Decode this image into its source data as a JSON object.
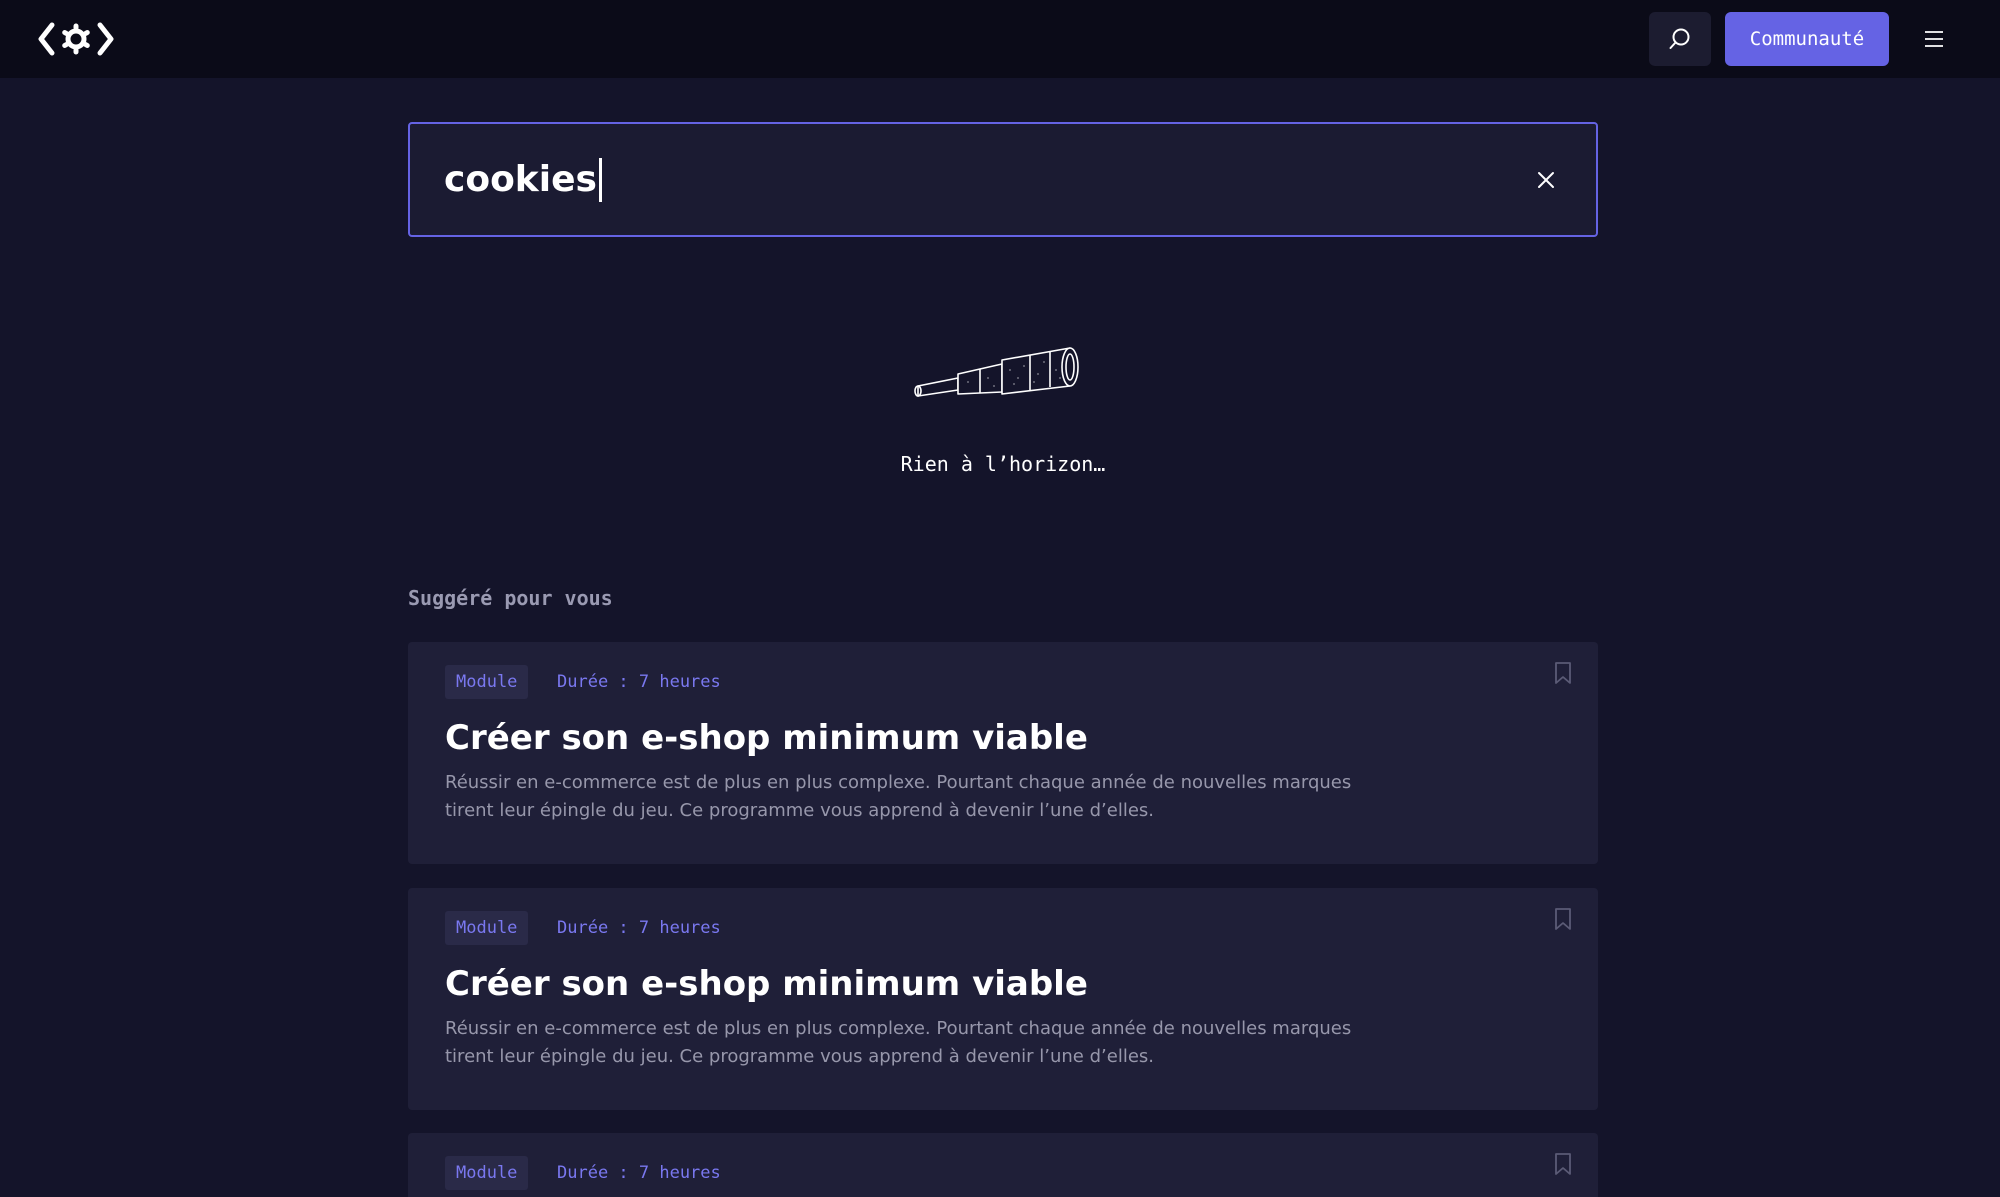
{
  "header": {
    "logo": "code-gear-logo",
    "community_label": "Communauté",
    "icons": {
      "search": "search-icon",
      "menu": "hamburger-menu-icon"
    },
    "accent_color": "#6563e4"
  },
  "search": {
    "value": "cookies",
    "clear_icon": "close-icon"
  },
  "empty_state": {
    "illustration": "telescope-illustration",
    "message": "Rien à l’horizon…"
  },
  "suggestions": {
    "title": "Suggéré pour vous",
    "cards": [
      {
        "tag": "Module",
        "duration": "Durée : 7 heures",
        "title": "Créer son e-shop minimum viable",
        "description": "Réussir en e-commerce est de plus en plus complexe. Pourtant chaque année de nouvelles marques tirent leur épingle du jeu. Ce programme vous apprend à devenir l’une d’elles."
      },
      {
        "tag": "Module",
        "duration": "Durée : 7 heures",
        "title": "Créer son e-shop minimum viable",
        "description": "Réussir en e-commerce est de plus en plus complexe. Pourtant chaque année de nouvelles marques tirent leur épingle du jeu. Ce programme vous apprend à devenir l’une d’elles."
      },
      {
        "tag": "Module",
        "duration": "Durée : 7 heures"
      }
    ]
  }
}
